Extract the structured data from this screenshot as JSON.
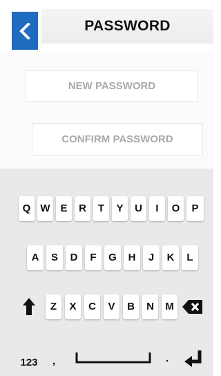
{
  "header": {
    "title": "PASSWORD",
    "back_icon": "chevron-left-icon"
  },
  "form": {
    "new_password_placeholder": "NEW PASSWORD",
    "confirm_password_placeholder": "CONFIRM PASSWORD"
  },
  "keyboard": {
    "row1": [
      "Q",
      "W",
      "E",
      "R",
      "T",
      "Y",
      "U",
      "I",
      "O",
      "P"
    ],
    "row2": [
      "A",
      "S",
      "D",
      "F",
      "G",
      "H",
      "J",
      "K",
      "L"
    ],
    "row3": [
      "Z",
      "X",
      "C",
      "V",
      "B",
      "N",
      "M"
    ],
    "bottom": {
      "numbers": "123",
      "comma": ",",
      "period": "."
    },
    "icons": {
      "shift": "shift-arrow-icon",
      "backspace": "backspace-icon",
      "space": "spacebar-icon",
      "enter": "enter-icon"
    }
  },
  "colors": {
    "accent": "#1f6bc0",
    "keyboard_bg": "#e9e9e9",
    "placeholder": "#a9a9a9"
  }
}
